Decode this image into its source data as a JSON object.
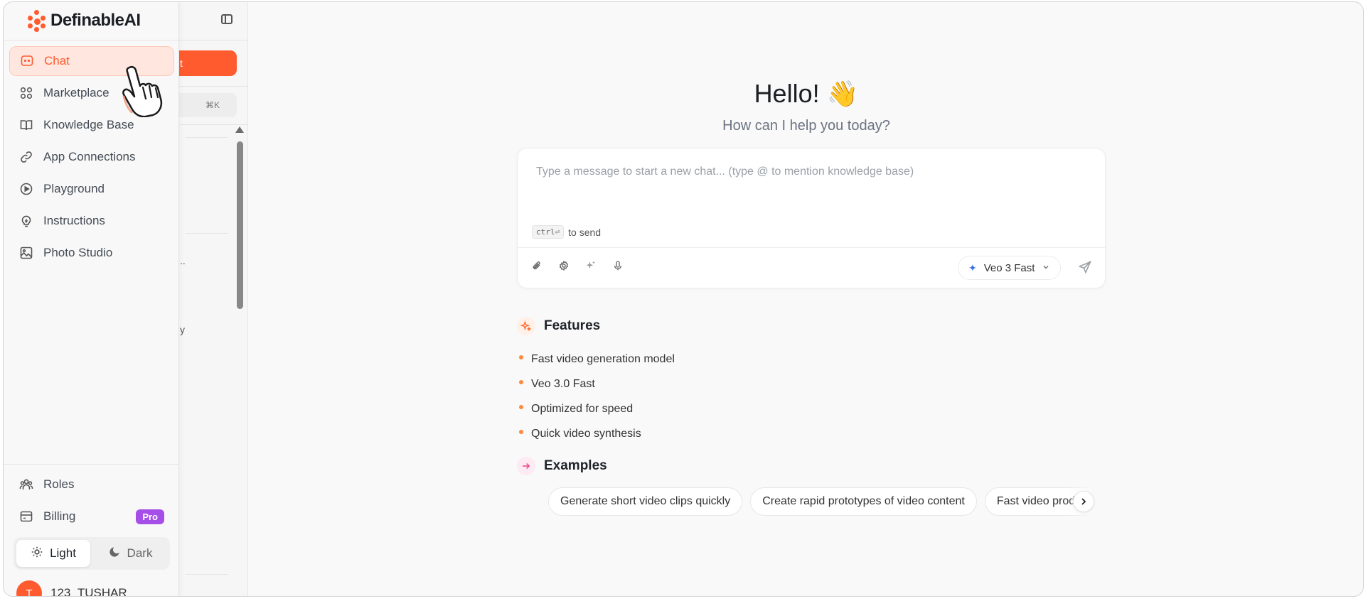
{
  "brand": {
    "name": "DefinableAI"
  },
  "sidebar": {
    "items": [
      {
        "label": "Chat",
        "icon": "chat-icon",
        "active": true
      },
      {
        "label": "Marketplace",
        "icon": "grid-icon"
      },
      {
        "label": "Knowledge Base",
        "icon": "book-icon"
      },
      {
        "label": "App Connections",
        "icon": "link-icon"
      },
      {
        "label": "Playground",
        "icon": "play-circle-icon"
      },
      {
        "label": "Instructions",
        "icon": "bulb-icon"
      },
      {
        "label": "Photo Studio",
        "icon": "image-icon"
      }
    ],
    "bottom": [
      {
        "label": "Roles",
        "icon": "users-icon"
      },
      {
        "label": "Billing",
        "icon": "billing-icon",
        "badge": "Pro"
      }
    ],
    "theme": {
      "light": "Light",
      "dark": "Dark",
      "selected": "light"
    },
    "user": {
      "initial": "T",
      "name": "123_TUSHAR"
    }
  },
  "subpanel": {
    "new_button_fragment": "t",
    "shortcut": "⌘K",
    "frag1": "..",
    "frag2": "y"
  },
  "main": {
    "greeting": "Hello! 👋",
    "subtitle": "How can I help you today?",
    "composer": {
      "placeholder": "Type a message to start a new chat... (type @ to mention knowledge base)",
      "shortcut_key": "ctrl⏎",
      "shortcut_text": "to send",
      "model": "Veo 3 Fast"
    },
    "features": {
      "title": "Features",
      "items": [
        "Fast video generation model",
        "Veo 3.0 Fast",
        "Optimized for speed",
        "Quick video synthesis"
      ]
    },
    "examples": {
      "title": "Examples",
      "items": [
        "Generate short video clips quickly",
        "Create rapid prototypes of video content",
        "Fast video production"
      ]
    }
  },
  "colors": {
    "accent": "#ff5b2e",
    "pro": "#a64ee8",
    "bullet": "#ff8a3d"
  }
}
